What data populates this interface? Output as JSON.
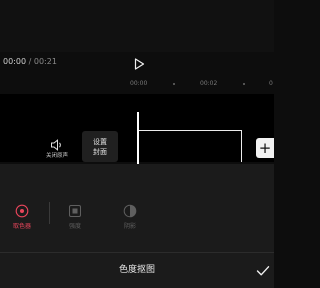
{
  "player": {
    "current_time": "00:00",
    "separator": "/",
    "total_time": "00:21"
  },
  "timeline": {
    "ticks": [
      "00:00",
      "00:02",
      "0"
    ],
    "mute_label": "关闭原声",
    "cover_label_line1": "设置",
    "cover_label_line2": "封面"
  },
  "tools": {
    "items": [
      {
        "label": "取色器",
        "state": "active",
        "icon": "target-icon"
      },
      {
        "label": "强度",
        "state": "disabled",
        "icon": "intensity-icon"
      },
      {
        "label": "阴影",
        "state": "disabled",
        "icon": "shadow-icon"
      }
    ]
  },
  "footer": {
    "title": "色度抠图"
  },
  "colors": {
    "accent": "#e8455b",
    "background": "#0d0d0d",
    "panel": "#1b1b1b",
    "disabled": "#5f5f5f"
  }
}
